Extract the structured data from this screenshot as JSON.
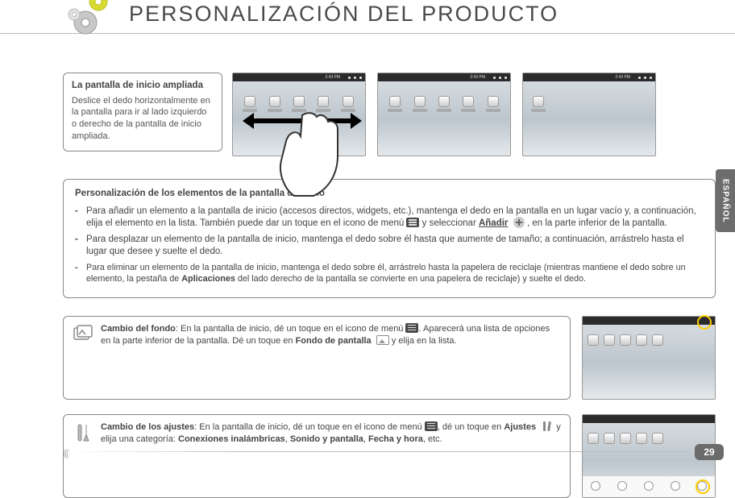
{
  "page": {
    "title": "PERSONALIZACIÓN DEL PRODUCTO",
    "language_tab": "ESPAÑOL",
    "page_number": "29"
  },
  "box_extended": {
    "title": "La pantalla de inicio ampliada",
    "body": "Deslice el dedo horizontalmente en la pantalla para ir al lado izquierdo o derecho de la pantalla de inicio ampliada."
  },
  "panel_customize": {
    "title": "Personalización de los elementos de la pantalla de inicio",
    "item1_a": "Para añadir un elemento a la pantalla de inicio (accesos directos, widgets, etc.), mantenga el dedo en la pantalla en un lugar vacío y, a continuación, elija el elemento en la lista. También puede dar un toque en el icono de menú ",
    "item1_b": " y seleccionar ",
    "item1_add": "Añadir",
    "item1_c": ", en la parte inferior de la pantalla.",
    "item2": "Para desplazar un elemento de la pantalla de inicio, mantenga el dedo sobre él hasta que aumente de tamaño; a continuación, arrástrelo hasta el lugar que desee y suelte el dedo.",
    "item3_a": "Para eliminar un elemento de la pantalla de inicio, mantenga el dedo sobre él, arrástrelo hasta la papelera de reciclaje (mientras mantiene el dedo sobre un elemento, la pestaña de ",
    "item3_apps": "Aplicaciones",
    "item3_b": " del lado derecho de la pantalla se convierte en una papelera de reciclaje) y suelte el dedo."
  },
  "strip_wallpaper": {
    "head": "Cambio del fondo",
    "a": ": En la pantalla de inicio, dé un toque en el icono de menú ",
    "b": ". Aparecerá una lista de opciones en la parte inferior de la pantalla. Dé un toque en ",
    "wall": "Fondo de pantalla",
    "c": " y elija en la lista."
  },
  "strip_settings": {
    "head": "Cambio de los ajustes",
    "a": ": En la pantalla de inicio, dé un toque en el icono de menú ",
    "b": ", dé un toque en ",
    "ajustes": "Ajustes",
    "c": " y elija una categoría: ",
    "cat1": "Conexiones inalámbricas",
    "cat2": "Sonido y pantalla",
    "cat3": "Fecha y hora",
    "etc": ", etc."
  },
  "status_time": "2:43 PM"
}
